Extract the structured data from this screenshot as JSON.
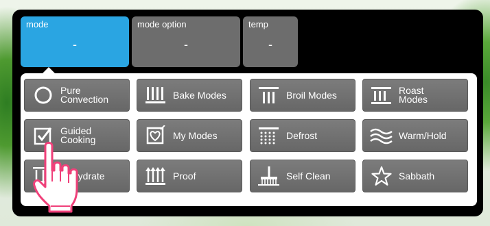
{
  "tabs": {
    "mode": {
      "label": "mode",
      "value": "-"
    },
    "mode_option": {
      "label": "mode option",
      "value": "-"
    },
    "temp": {
      "label": "temp",
      "value": "-"
    }
  },
  "modes": {
    "pure_convection": {
      "line1": "Pure",
      "line2": "Convection",
      "icon": "circle-icon"
    },
    "bake_modes": {
      "label": "Bake Modes",
      "icon": "bake-bars-icon"
    },
    "broil_modes": {
      "label": "Broil Modes",
      "icon": "broil-icon"
    },
    "roast_modes": {
      "line1": "Roast",
      "line2": "Modes",
      "icon": "roast-bars-icon"
    },
    "guided_cooking": {
      "line1": "Guided",
      "line2": "Cooking",
      "icon": "checkbox-icon"
    },
    "my_modes": {
      "label": "My Modes",
      "icon": "heart-icon"
    },
    "defrost": {
      "label": "Defrost",
      "icon": "defrost-dots-icon"
    },
    "warm_hold": {
      "label": "Warm/Hold",
      "icon": "waves-icon"
    },
    "dehydrate": {
      "label": "Dehydrate",
      "icon": "dehydrate-arrows-icon"
    },
    "proof": {
      "label": "Proof",
      "icon": "proof-arrows-icon"
    },
    "self_clean": {
      "label": "Self Clean",
      "icon": "broom-icon"
    },
    "sabbath": {
      "label": "Sabbath",
      "icon": "star-icon"
    }
  },
  "colors": {
    "accent": "#2aa5e2",
    "button": "#6d6d6d",
    "cursor": "#f0407a"
  }
}
